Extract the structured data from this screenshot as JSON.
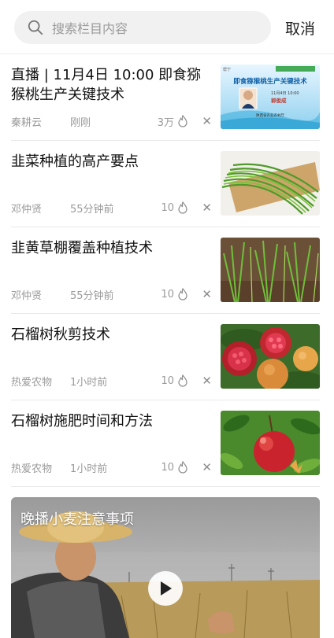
{
  "search": {
    "placeholder": "搜索栏目内容",
    "cancel_label": "取消"
  },
  "articles": [
    {
      "title": "直播 | 11月4日 10:00 即食猕猴桃生产关键技术",
      "author": "秦耕云",
      "time": "刚刚",
      "count": "3万"
    },
    {
      "title": "韭菜种植的高产要点",
      "author": "邓仲贤",
      "time": "55分钟前",
      "count": "10"
    },
    {
      "title": "韭黄草棚覆盖种植技术",
      "author": "邓仲贤",
      "time": "55分钟前",
      "count": "10"
    },
    {
      "title": "石榴树秋剪技术",
      "author": "热爱农物",
      "time": "1小时前",
      "count": "10"
    },
    {
      "title": "石榴树施肥时间和方法",
      "author": "热爱农物",
      "time": "1小时前",
      "count": "10"
    }
  ],
  "thumb1": {
    "tag": "帮宁",
    "headline": "即食猕猴桃生产关键技术",
    "speaker": "郭俊成",
    "date": "11月4日 10:00",
    "org": "陕西省农业农村厅"
  },
  "video": {
    "title": "晚播小麦注意事项"
  },
  "icons": {
    "search": "search-icon",
    "fire": "fire-icon",
    "close": "close-icon",
    "play": "play-icon"
  },
  "colors": {
    "accent": "#1e8fd6"
  }
}
